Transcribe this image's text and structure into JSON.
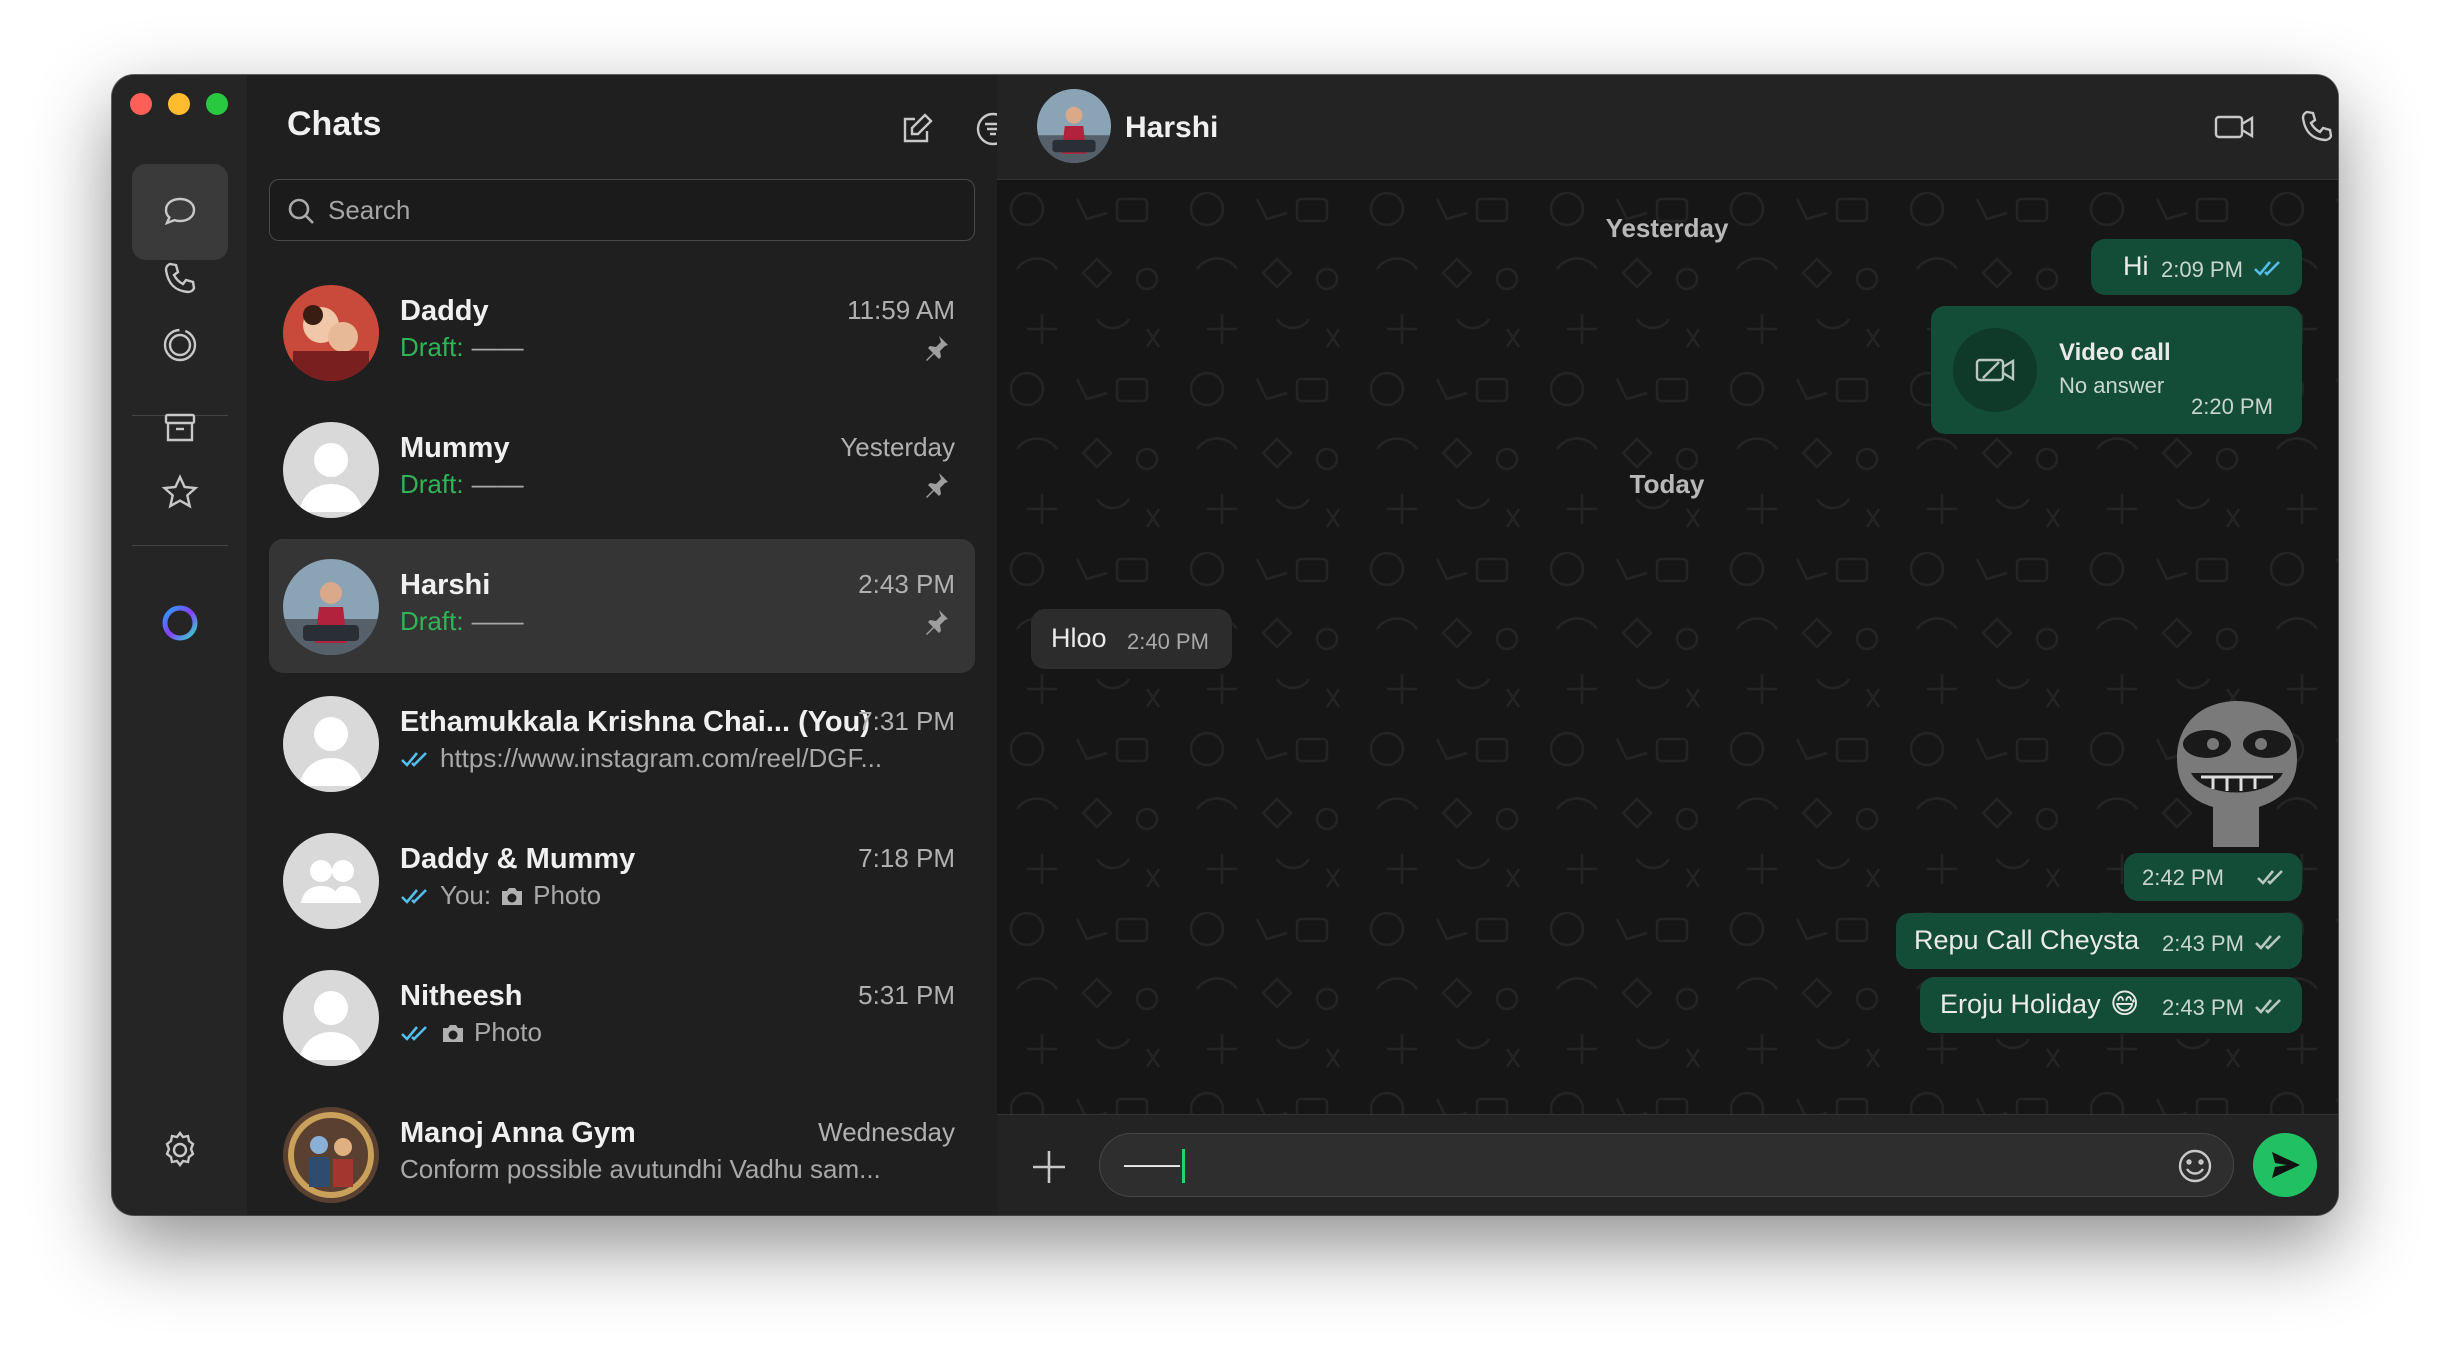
{
  "rail": {
    "items": [
      "chats-icon",
      "calls-icon",
      "status-icon",
      "archive-icon",
      "starred-icon",
      "meta-ai-icon",
      "settings-icon"
    ]
  },
  "chat_list": {
    "title": "Chats",
    "search_placeholder": "Search",
    "chats": [
      {
        "name": "Daddy",
        "time": "11:59 AM",
        "draft_label": "Draft:",
        "preview": "——",
        "pinned": true
      },
      {
        "name": "Mummy",
        "time": "Yesterday",
        "draft_label": "Draft:",
        "preview": "——",
        "pinned": true
      },
      {
        "name": "Harshi",
        "time": "2:43 PM",
        "draft_label": "Draft:",
        "preview": "——",
        "pinned": true,
        "selected": true
      },
      {
        "name": "Ethamukkala Krishna Chai... (You)",
        "time": "7:31 PM",
        "preview": "https://www.instagram.com/reel/DGF..."
      },
      {
        "name": "Daddy & Mummy",
        "time": "7:18 PM",
        "you_label": "You:",
        "preview": "Photo"
      },
      {
        "name": "Nitheesh",
        "time": "5:31 PM",
        "preview": "Photo"
      },
      {
        "name": "Manoj Anna Gym",
        "time": "Wednesday",
        "preview": "Conform possible avutundhi Vadhu sam..."
      }
    ]
  },
  "conversation": {
    "contact_name": "Harshi",
    "dates": {
      "yesterday": "Yesterday",
      "today": "Today"
    },
    "messages": {
      "hi": {
        "text": "Hi",
        "time": "2:09 PM"
      },
      "video_call": {
        "title": "Video call",
        "status": "No answer",
        "time": "2:20 PM"
      },
      "hloo": {
        "text": "Hloo",
        "time": "2:40 PM"
      },
      "sticker": {
        "time": "2:42 PM"
      },
      "repu": {
        "text": "Repu Call Cheysta",
        "time": "2:43 PM"
      },
      "eroju": {
        "text": "Eroju Holiday",
        "emoji": "😅",
        "time": "2:43 PM"
      }
    },
    "composer": {
      "value": "——"
    }
  },
  "colors": {
    "accent_green": "#21c063",
    "outgoing_bubble": "#144d37",
    "read_tick": "#53bdeb",
    "draft_label": "#2fb457"
  }
}
